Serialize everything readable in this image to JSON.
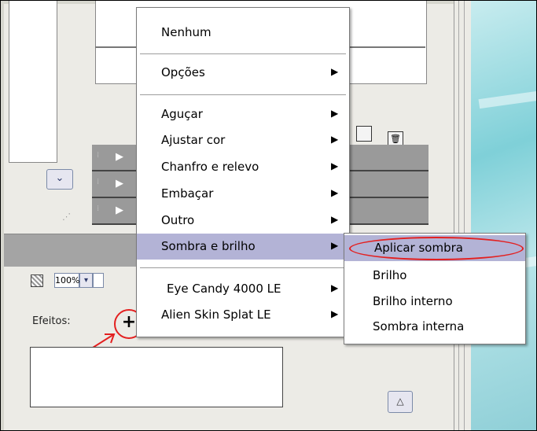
{
  "main_menu": {
    "items": [
      {
        "label": "Nenhum",
        "has_submenu": false
      },
      {
        "label": "Opções",
        "has_submenu": true
      },
      {
        "label": "Aguçar",
        "has_submenu": true
      },
      {
        "label": "Ajustar cor",
        "has_submenu": true
      },
      {
        "label": "Chanfro e relevo",
        "has_submenu": true
      },
      {
        "label": "Embaçar",
        "has_submenu": true
      },
      {
        "label": "Outro",
        "has_submenu": true
      },
      {
        "label": "Sombra e brilho",
        "has_submenu": true,
        "highlighted": true
      },
      {
        "label": "Eye Candy 4000 LE",
        "has_submenu": true
      },
      {
        "label": "Alien Skin Splat LE",
        "has_submenu": true
      }
    ]
  },
  "submenu": {
    "items": [
      {
        "label": "Aplicar sombra",
        "highlighted": true,
        "circled": true
      },
      {
        "label": "Brilho"
      },
      {
        "label": "Brilho interno"
      },
      {
        "label": "Sombra interna"
      }
    ]
  },
  "effects_panel": {
    "zoom_value": "100%",
    "effects_label": "Efeitos:",
    "add_button_icon": "plus-icon"
  },
  "icons": {
    "submenu_arrow": "▶",
    "dropdown": "▾",
    "expand": "△"
  },
  "colors": {
    "menu_highlight": "#b3b3d6",
    "annotation_red": "#e32020"
  }
}
